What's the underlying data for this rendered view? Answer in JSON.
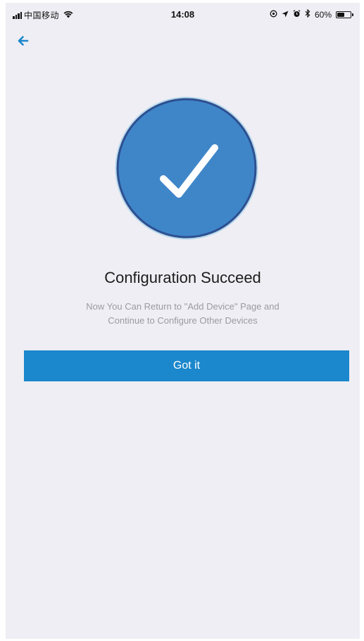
{
  "status_bar": {
    "carrier": "中国移动",
    "time": "14:08",
    "battery_percent": "60%",
    "battery_level": 0.6,
    "icons": [
      "signal-icon",
      "wifi-icon",
      "location-icon",
      "alarm-icon",
      "bluetooth-icon",
      "battery-icon"
    ]
  },
  "nav": {
    "back_icon": "arrow-left-icon"
  },
  "success": {
    "icon": "checkmark-icon",
    "title": "Configuration Succeed",
    "message_line1": "Now You Can Return to \"Add Device\" Page and",
    "message_line2": "Continue to Configure Other Devices"
  },
  "actions": {
    "got_it_label": "Got it"
  },
  "colors": {
    "background": "#efeef4",
    "accent": "#1b87cc",
    "badge_fill": "#3f86c9",
    "badge_ring": "#2e4f8f"
  }
}
